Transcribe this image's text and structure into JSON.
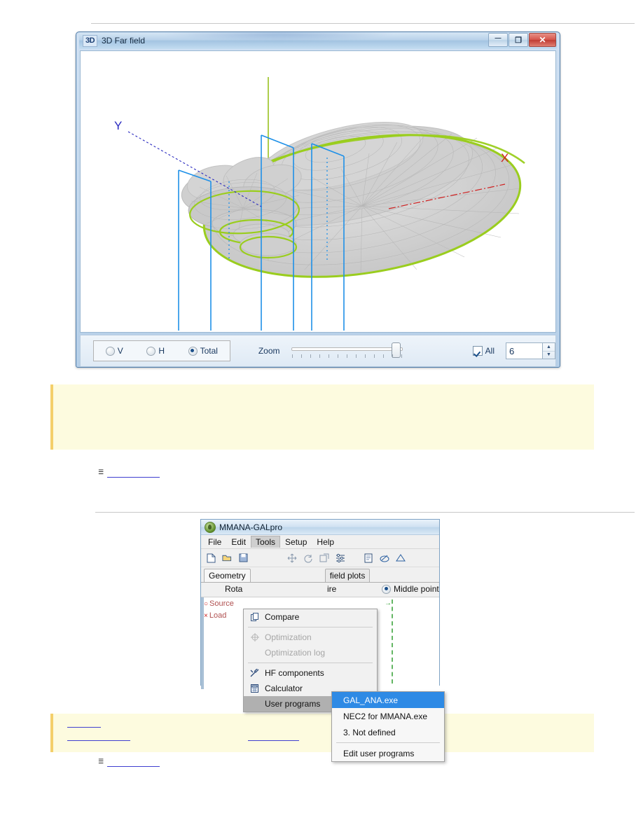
{
  "window3d": {
    "badge": "3D",
    "title": "3D Far field",
    "buttons": {
      "minimize": "—",
      "maximize": "❐",
      "close": "✕"
    },
    "axis_labels": {
      "x": "X",
      "y": "Y"
    },
    "controls": {
      "radios": [
        {
          "label": "V",
          "selected": false
        },
        {
          "label": "H",
          "selected": false
        },
        {
          "label": "Total",
          "selected": true
        }
      ],
      "zoom_label": "Zoom",
      "zoom_value": 86,
      "all_checkbox": {
        "label": "All",
        "checked": true
      },
      "count_value": "6",
      "spinner_up": "▲",
      "spinner_down": "▼"
    }
  },
  "mmana": {
    "title": "MMANA-GALpro",
    "menubar": [
      "File",
      "Edit",
      "Tools",
      "Setup",
      "Help"
    ],
    "active_menu": "Tools",
    "toolbar_icons": [
      "new-file-icon",
      "open-folder-icon",
      "save-icon",
      "move-icon",
      "rotate-icon",
      "scale-icon",
      "settings-sliders-icon",
      "document-icon",
      "edit-icon",
      "triangle-icon"
    ],
    "tabs": [
      {
        "label": "Geometry",
        "selected": true
      },
      {
        "label": "field plots",
        "selected": false
      }
    ],
    "body": {
      "rota_label": "Rota",
      "wire_label": "ire",
      "middle_point": {
        "label": "Middle point",
        "selected": true
      },
      "markers": [
        {
          "glyph": "○",
          "label": "Source"
        },
        {
          "glyph": "×",
          "label": "Load"
        }
      ]
    },
    "tools_menu": [
      {
        "label": "Compare",
        "icon": "compare-icon",
        "disabled": false
      },
      {
        "label": "Optimization",
        "icon": "optimization-icon",
        "disabled": true
      },
      {
        "label": "Optimization log",
        "icon": "",
        "disabled": true
      },
      {
        "label": "HF components",
        "icon": "hf-components-icon",
        "disabled": false
      },
      {
        "label": "Calculator",
        "icon": "calculator-icon",
        "disabled": false
      },
      {
        "label": "User programs",
        "icon": "",
        "disabled": false,
        "submenu_arrow": "▶",
        "highlighted": true
      }
    ],
    "user_programs_menu": [
      {
        "label": "GAL_ANA.exe",
        "selected": true
      },
      {
        "label": "NEC2 for MMANA.exe",
        "selected": false
      },
      {
        "label": "3. Not defined",
        "selected": false
      },
      {
        "label": "Edit user programs",
        "selected": false
      }
    ]
  },
  "colors": {
    "pattern_mesh": "#c9c9c9",
    "pattern_outline": "#9acd1e",
    "wire_blue": "#1e90e8",
    "axis_y": "#2a2ac0",
    "axis_x": "#d02020",
    "axis_z": "#8ab800",
    "note_bg": "#fdfbdf",
    "note_border": "#f4cf6a",
    "link": "#1a1ac8",
    "selection": "#2e8ae5"
  },
  "notes": {
    "note1_links": [],
    "note2_links": [
      "",
      "",
      ""
    ]
  }
}
